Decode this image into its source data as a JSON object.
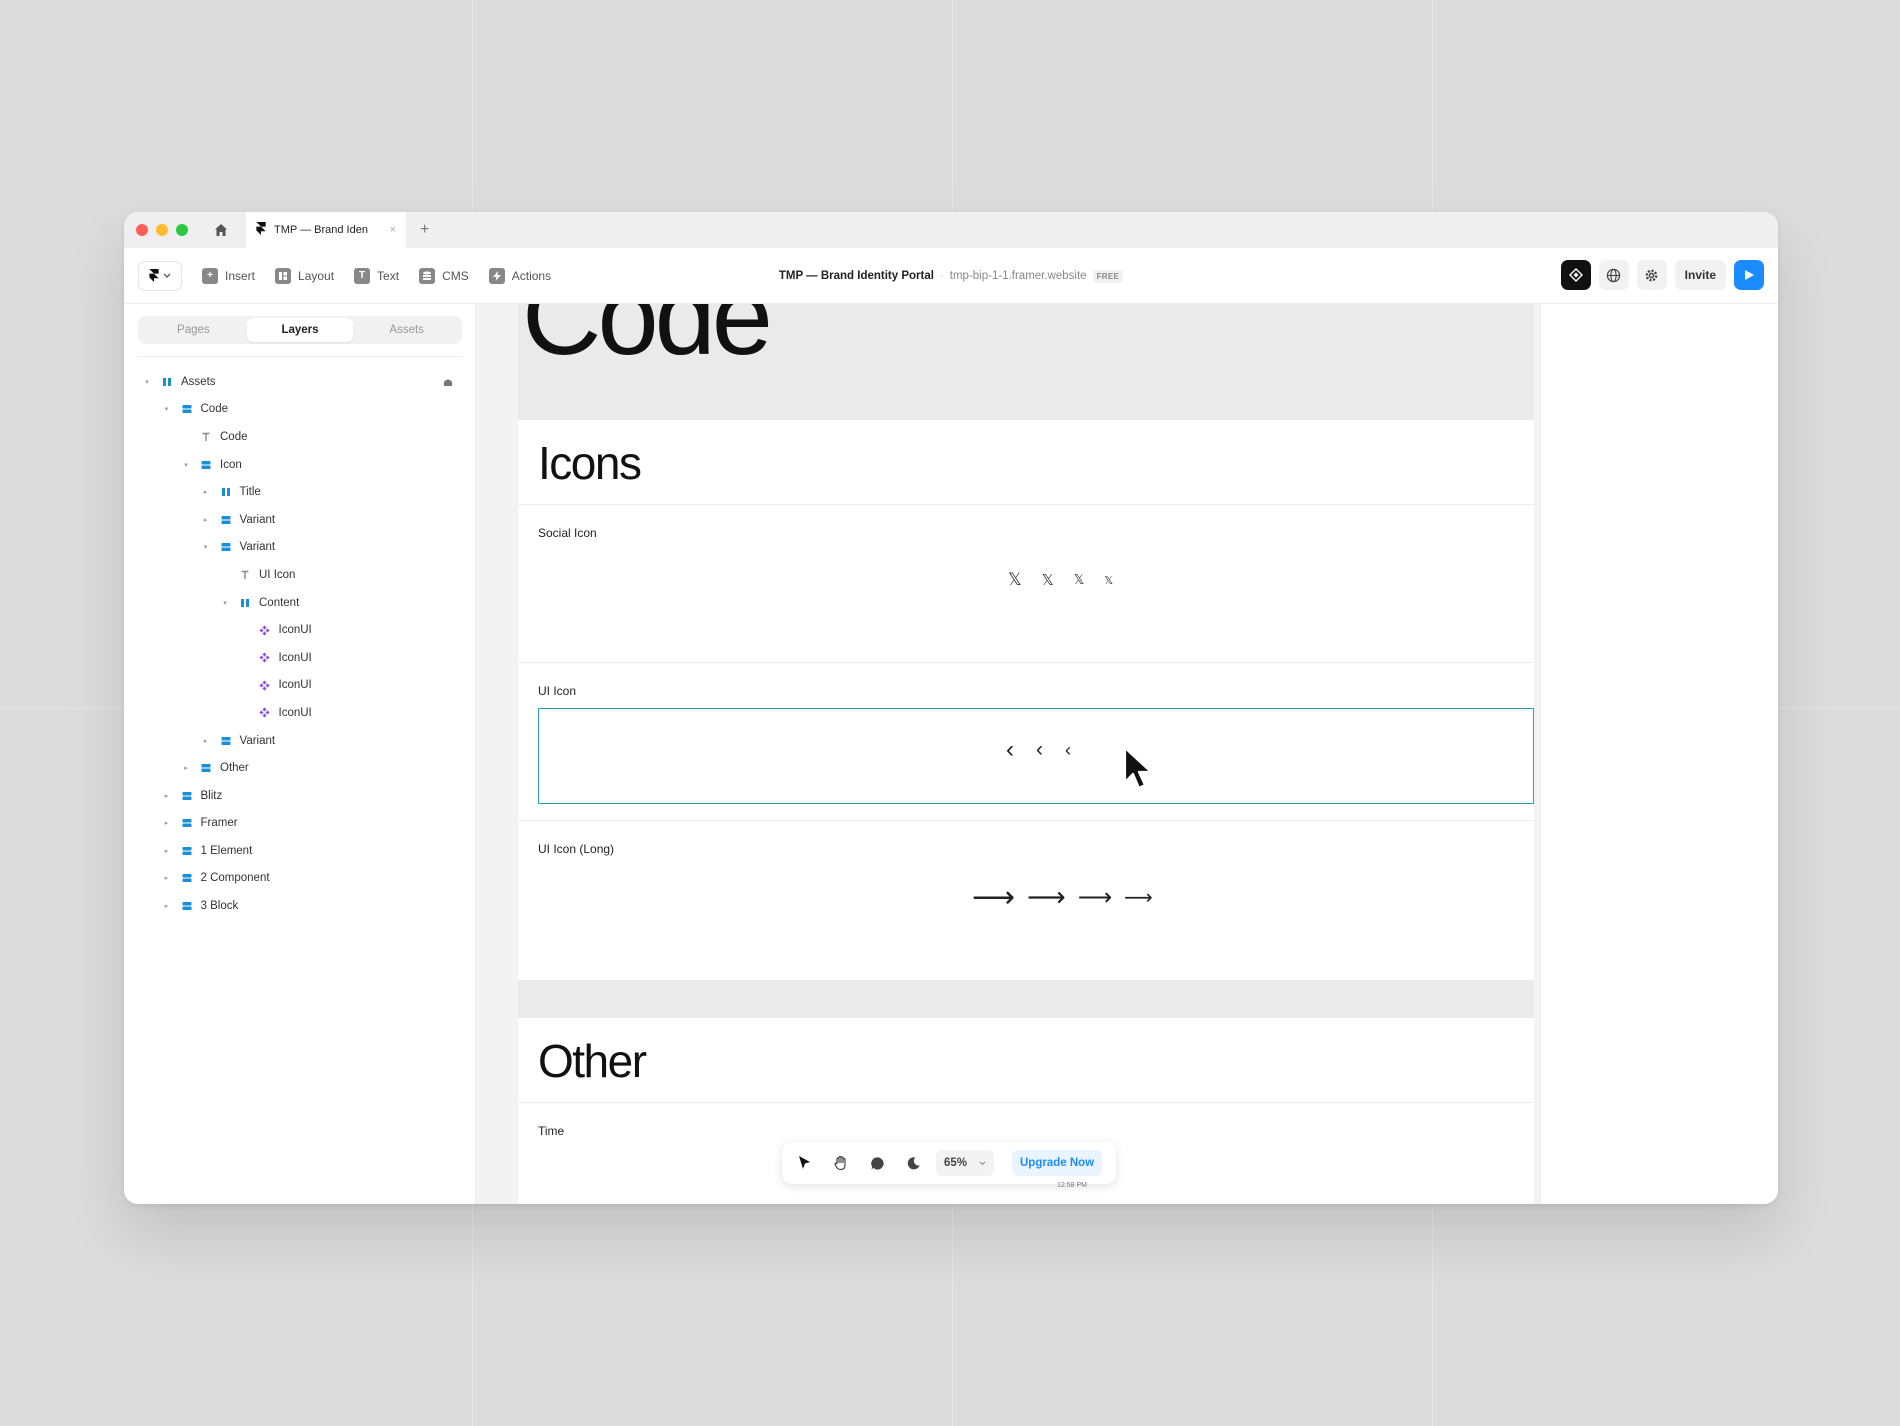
{
  "window": {
    "traffic_colors": [
      "#ff5f57",
      "#febc2e",
      "#28c840"
    ],
    "tab_title": "TMP — Brand Iden",
    "tab_close": "×",
    "new_tab": "+"
  },
  "toolbar": {
    "tools": [
      {
        "label": "Insert",
        "icon": "plus-icon"
      },
      {
        "label": "Layout",
        "icon": "layout-icon"
      },
      {
        "label": "Text",
        "icon": "text-icon"
      },
      {
        "label": "CMS",
        "icon": "database-icon"
      },
      {
        "label": "Actions",
        "icon": "bolt-icon"
      }
    ],
    "project_title": "TMP — Brand Identity Portal",
    "separator": "·",
    "url": "tmp-bip-1-1.framer.website",
    "plan_badge": "FREE",
    "invite_label": "Invite",
    "accent": "#1b8cff"
  },
  "sidebar": {
    "tabs": [
      "Pages",
      "Layers",
      "Assets"
    ],
    "active_tab": "Layers",
    "tree": [
      {
        "label": "Assets",
        "level": 0,
        "caret": "open",
        "icon": "stack-icon",
        "lock": true
      },
      {
        "label": "Code",
        "level": 1,
        "caret": "open",
        "icon": "frame-icon"
      },
      {
        "label": "Code",
        "level": 2,
        "caret": "none",
        "icon": "text-icon"
      },
      {
        "label": "Icon",
        "level": 2,
        "caret": "open",
        "icon": "frame-icon"
      },
      {
        "label": "Title",
        "level": 3,
        "caret": "closed",
        "icon": "stack-icon"
      },
      {
        "label": "Variant",
        "level": 3,
        "caret": "closed",
        "icon": "frame-icon"
      },
      {
        "label": "Variant",
        "level": 3,
        "caret": "open",
        "icon": "frame-icon"
      },
      {
        "label": "UI Icon",
        "level": 4,
        "caret": "none",
        "icon": "text-icon"
      },
      {
        "label": "Content",
        "level": 4,
        "caret": "open",
        "icon": "stack-icon"
      },
      {
        "label": "IconUI",
        "level": 5,
        "caret": "none",
        "icon": "component-icon"
      },
      {
        "label": "IconUI",
        "level": 5,
        "caret": "none",
        "icon": "component-icon"
      },
      {
        "label": "IconUI",
        "level": 5,
        "caret": "none",
        "icon": "component-icon"
      },
      {
        "label": "IconUI",
        "level": 5,
        "caret": "none",
        "icon": "component-icon"
      },
      {
        "label": "Variant",
        "level": 3,
        "caret": "closed",
        "icon": "frame-icon"
      },
      {
        "label": "Other",
        "level": 2,
        "caret": "closed",
        "icon": "frame-icon"
      },
      {
        "label": "Blitz",
        "level": 1,
        "caret": "closed",
        "icon": "frame-icon"
      },
      {
        "label": "Framer",
        "level": 1,
        "caret": "closed",
        "icon": "frame-icon"
      },
      {
        "label": "1 Element",
        "level": 1,
        "caret": "closed",
        "icon": "frame-icon"
      },
      {
        "label": "2 Component",
        "level": 1,
        "caret": "closed",
        "icon": "frame-icon"
      },
      {
        "label": "3 Block",
        "level": 1,
        "caret": "closed",
        "icon": "frame-icon"
      }
    ],
    "frame_icon_color": "#1a8fd8",
    "component_icon_color": "#8a4dff"
  },
  "canvas": {
    "code_title": "Code",
    "icons_title": "Icons",
    "social_label": "Social Icon",
    "social_glyph": "𝕏",
    "ui_label": "UI Icon",
    "ui_glyph": "‹",
    "ui_long_label": "UI Icon (Long)",
    "ui_long_glyph": "⟶",
    "other_title": "Other",
    "time_label": "Time",
    "time_value": "12:58 PM",
    "selection_color": "#2aa0c0"
  },
  "bottom_bar": {
    "zoom": "65%",
    "upgrade_label": "Upgrade Now"
  }
}
